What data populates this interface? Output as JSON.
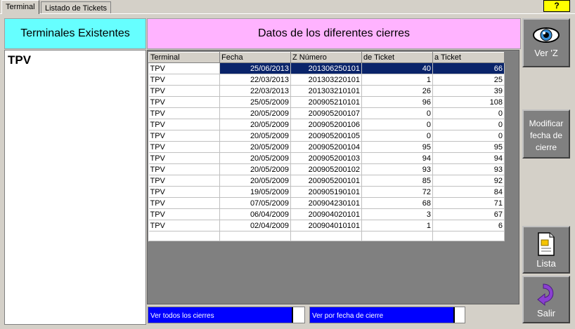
{
  "tabs": [
    {
      "label": "Terminal",
      "active": true
    },
    {
      "label": "Listado de Tickets",
      "active": false
    }
  ],
  "help": {
    "label": "?"
  },
  "terminals_panel": {
    "title": "Terminales Existentes",
    "items": [
      "TPV"
    ]
  },
  "closures_panel": {
    "title": "Datos de los diferentes cierres",
    "columns": [
      "Terminal",
      "Fecha",
      "Z Número",
      "de Ticket",
      "a Ticket"
    ],
    "rows": [
      [
        "TPV",
        "25/06/2013",
        "201306250101",
        "40",
        "66"
      ],
      [
        "TPV",
        "22/03/2013",
        "201303220101",
        "1",
        "25"
      ],
      [
        "TPV",
        "22/03/2013",
        "201303210101",
        "26",
        "39"
      ],
      [
        "TPV",
        "25/05/2009",
        "200905210101",
        "96",
        "108"
      ],
      [
        "TPV",
        "20/05/2009",
        "200905200107",
        "0",
        "0"
      ],
      [
        "TPV",
        "20/05/2009",
        "200905200106",
        "0",
        "0"
      ],
      [
        "TPV",
        "20/05/2009",
        "200905200105",
        "0",
        "0"
      ],
      [
        "TPV",
        "20/05/2009",
        "200905200104",
        "95",
        "95"
      ],
      [
        "TPV",
        "20/05/2009",
        "200905200103",
        "94",
        "94"
      ],
      [
        "TPV",
        "20/05/2009",
        "200905200102",
        "93",
        "93"
      ],
      [
        "TPV",
        "20/05/2009",
        "200905200101",
        "85",
        "92"
      ],
      [
        "TPV",
        "19/05/2009",
        "200905190101",
        "72",
        "84"
      ],
      [
        "TPV",
        "07/05/2009",
        "200904230101",
        "68",
        "71"
      ],
      [
        "TPV",
        "06/04/2009",
        "200904020101",
        "3",
        "67"
      ],
      [
        "TPV",
        "02/04/2009",
        "200904010101",
        "1",
        "6"
      ]
    ],
    "selected_row": 0
  },
  "bottom_buttons": {
    "all_closures": "Ver todos los cierres",
    "by_date": "Ver por fecha de cierre"
  },
  "side_buttons": {
    "ver_z": "Ver 'Z",
    "modify_date": [
      "Modificar",
      "fecha de",
      "cierre"
    ],
    "list": "Lista",
    "exit": "Salir"
  },
  "icons": {
    "ver_z": "eye-icon",
    "list": "document-icon",
    "exit": "curved-arrow-icon"
  },
  "colors": {
    "terminals_header": "#66ffff",
    "closures_header": "#ffb3ff",
    "selection": "#0a246a",
    "help_button": "#ffff00",
    "bottom_bar": "#0000ff"
  }
}
